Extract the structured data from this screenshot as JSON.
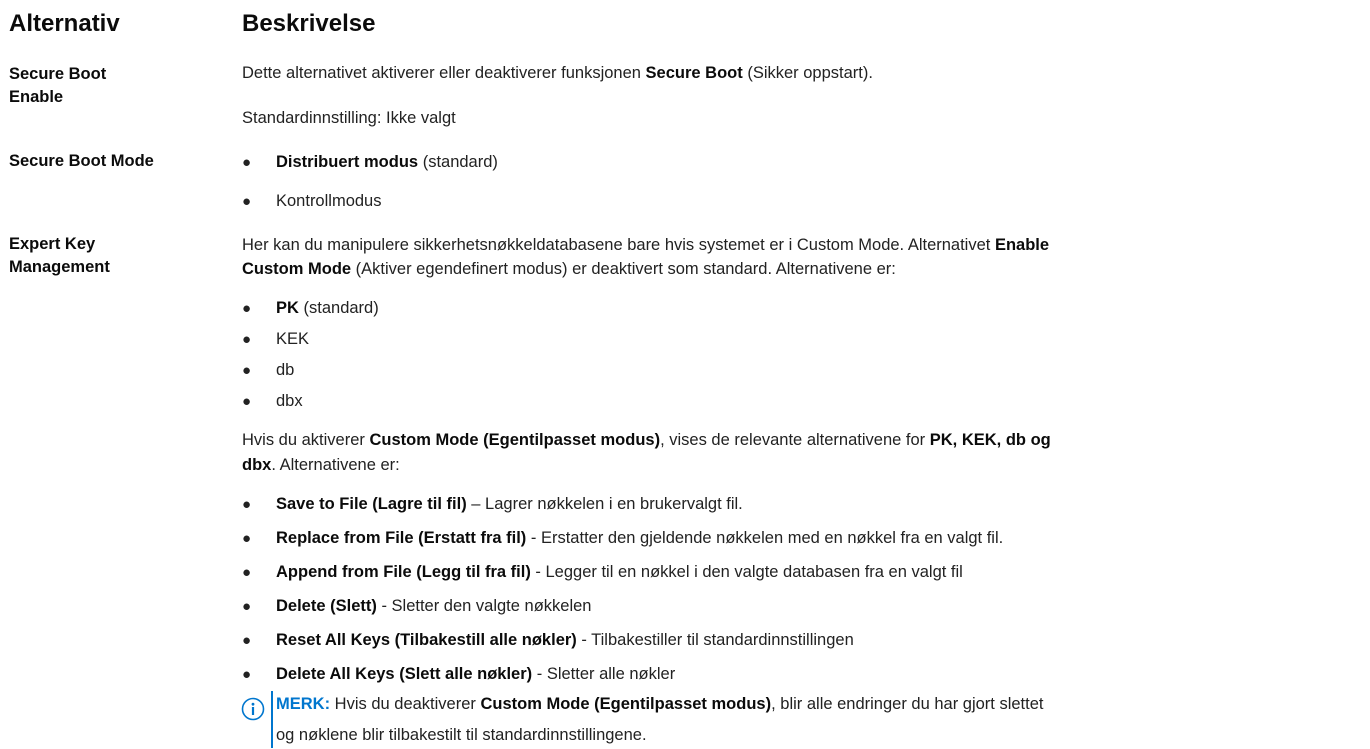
{
  "header": {
    "col1": "Alternativ",
    "col2": "Beskrivelse"
  },
  "rows": {
    "secure_boot_enable": {
      "label_line1": "Secure Boot",
      "label_line2": "Enable",
      "desc_pre": "Dette alternativet aktiverer eller deaktiverer funksjonen ",
      "desc_bold": "Secure Boot",
      "desc_post": " (Sikker oppstart).",
      "default": "Standardinnstilling: Ikke valgt"
    },
    "secure_boot_mode": {
      "label": "Secure Boot Mode",
      "options": [
        {
          "bold": "Distribuert modus",
          "text": " (standard)"
        },
        {
          "bold": "",
          "text": "Kontrollmodus"
        }
      ]
    },
    "expert_key_management": {
      "label_line1": "Expert Key",
      "label_line2": "Management",
      "intro1_pre": "Her kan du manipulere sikkerhetsnøkkeldatabasene bare hvis systemet er i Custom Mode. Alternativet ",
      "intro1_bold": "Enable",
      "intro2_bold": "Custom Mode",
      "intro2_post": " (Aktiver egendefinert modus) er deaktivert som standard. Alternativene er:",
      "keys": [
        {
          "bold": "PK",
          "text": " (standard)"
        },
        {
          "bold": "",
          "text": "KEK"
        },
        {
          "bold": "",
          "text": "db"
        },
        {
          "bold": "",
          "text": "dbx"
        }
      ],
      "custom1_pre": "Hvis du aktiverer ",
      "custom1_bold1": "Custom Mode (Egentilpasset modus)",
      "custom1_mid": ", vises de relevante alternativene for ",
      "custom1_bold2": "PK, KEK, db og",
      "custom2_bold": "dbx",
      "custom2_post": ". Alternativene er:",
      "actions": [
        {
          "bold": "Save to File (Lagre til fil)",
          "text": " – Lagrer nøkkelen i en brukervalgt fil."
        },
        {
          "bold": "Replace from File (Erstatt fra fil)",
          "text": " - Erstatter den gjeldende nøkkelen med en nøkkel fra en valgt fil."
        },
        {
          "bold": "Append from File (Legg til fra fil)",
          "text": " - Legger til en nøkkel i den valgte databasen fra en valgt fil"
        },
        {
          "bold": "Delete (Slett)",
          "text": " - Sletter den valgte nøkkelen"
        },
        {
          "bold": "Reset All Keys (Tilbakestill alle nøkler)",
          "text": " - Tilbakestiller til standardinnstillingen"
        },
        {
          "bold": "Delete All Keys (Slett alle nøkler)",
          "text": " - Sletter alle nøkler"
        }
      ],
      "note": {
        "label": "MERK:",
        "line1_pre": " Hvis du deaktiverer ",
        "line1_bold": "Custom Mode (Egentilpasset modus)",
        "line1_post": ", blir alle endringer du har gjort slettet",
        "line2": "og nøklene blir tilbakestilt til standardinnstillingene."
      }
    }
  },
  "colors": {
    "note_accent": "#0076ce",
    "text": "#222222"
  },
  "icons": {
    "note": "info-circle-icon",
    "bullet": "bullet-icon"
  }
}
